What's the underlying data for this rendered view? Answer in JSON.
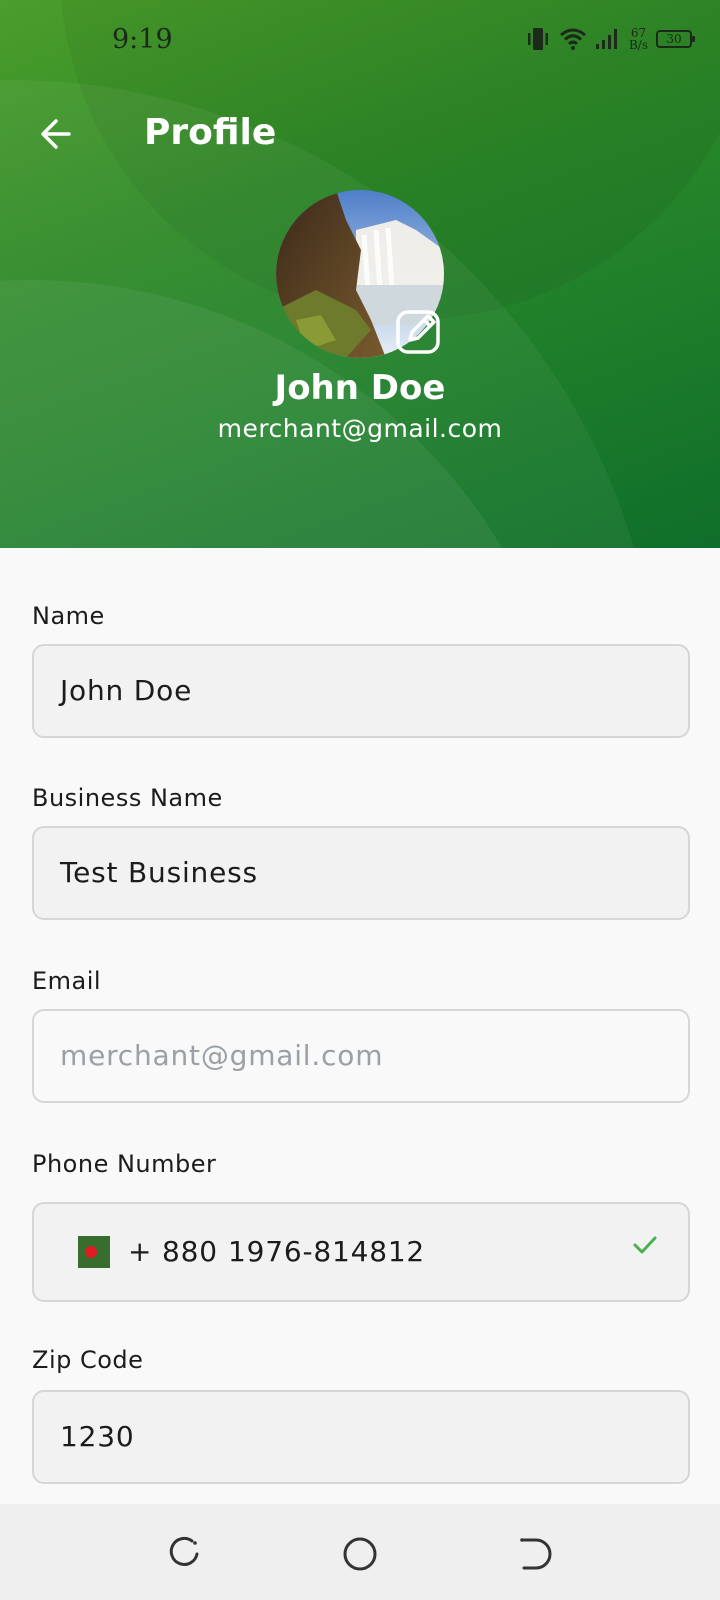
{
  "status_bar": {
    "time": "9:19",
    "net_speed_value": "67",
    "net_speed_unit": "B/s",
    "battery": "30",
    "icons": [
      "vibrate-icon",
      "wifi-icon",
      "signal-icon",
      "battery-icon"
    ]
  },
  "header": {
    "title": "Profile",
    "back_icon": "arrow-left-icon",
    "edit_icon": "edit-pencil-icon"
  },
  "profile": {
    "name": "John Doe",
    "email": "merchant@gmail.com"
  },
  "form": {
    "name": {
      "label": "Name",
      "value": "John Doe"
    },
    "business": {
      "label": "Business Name",
      "value": "Test Business"
    },
    "email": {
      "label": "Email",
      "placeholder": "merchant@gmail.com"
    },
    "phone": {
      "label": "Phone Number",
      "code": "+ 880",
      "number": "1976-814812",
      "valid": true
    },
    "zip": {
      "label": "Zip Code",
      "value": "1230"
    }
  },
  "nav": {
    "icons": [
      "recents-icon",
      "home-icon",
      "back-icon"
    ]
  },
  "colors": {
    "header_green": "#2f8a28",
    "check_green": "#4caf50",
    "flag_green": "#376e2e",
    "flag_red": "#e01b24"
  }
}
